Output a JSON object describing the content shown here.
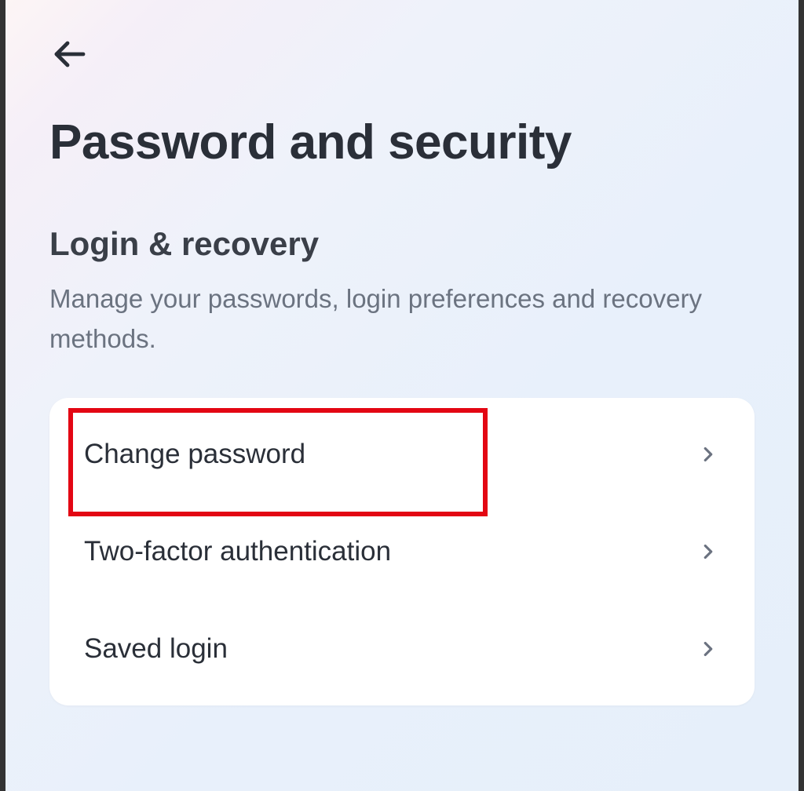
{
  "page": {
    "title": "Password and security"
  },
  "section": {
    "title": "Login & recovery",
    "description": "Manage your passwords, login preferences and recovery methods."
  },
  "items": [
    {
      "label": "Change password"
    },
    {
      "label": "Two-factor authentication"
    },
    {
      "label": "Saved login"
    }
  ]
}
